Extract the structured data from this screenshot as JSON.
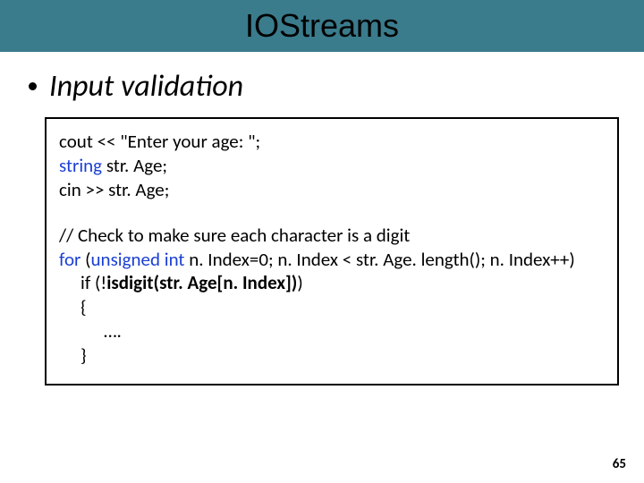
{
  "title": "IOStreams",
  "bullet": "Input validation",
  "code": {
    "l1a": "cout << \"Enter your age: \";",
    "l2kw": "string",
    "l2rest": " str. Age;",
    "l3": "cin >> str. Age;",
    "c1": "// Check to make sure each character is a digit",
    "f_for": "for",
    "f_open": " (",
    "f_kw2": "unsigned int",
    "f_rest": " n. Index=0; n. Index < str. Age. length(); n. Index++)",
    "if_a": "if (!",
    "if_hl": "isdigit(str. Age[n. Index])",
    "if_b": ")",
    "brace_o": "{",
    "dots": "…. ",
    "brace_c": "}"
  },
  "page": "65"
}
